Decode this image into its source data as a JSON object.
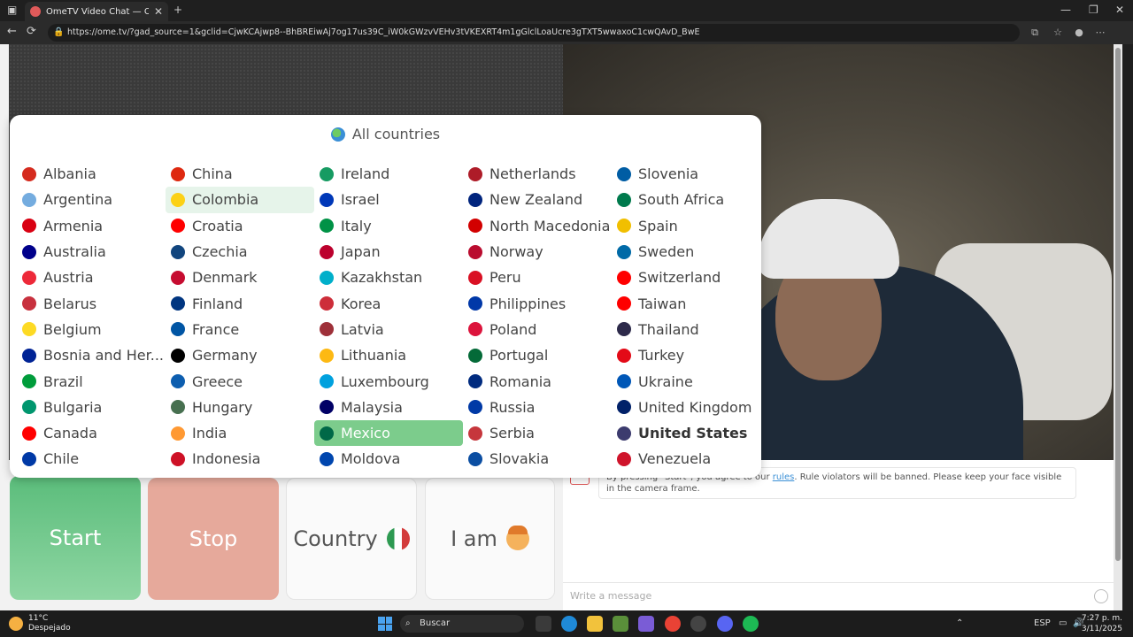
{
  "browser": {
    "tab_title": "OmeTV Video Chat — Ome...",
    "url": "https://ome.tv/?gad_source=1&gclid=CjwKCAjwp8--BhBREiwAj7og17us39C_iW0kGWzvVEHv3tVKEXRT4m1gGlclLoaUcre3gTXT5wwaxoC1cwQAvD_BwE",
    "new_tab": "+",
    "min": "—",
    "restore": "❐",
    "close": "✕",
    "back": "←",
    "reload": "⟳"
  },
  "popup": {
    "title": "All countries",
    "countries": [
      {
        "name": "Albania",
        "flag": "#d52b1e"
      },
      {
        "name": "China",
        "flag": "#de2910"
      },
      {
        "name": "Ireland",
        "flag": "#169b62"
      },
      {
        "name": "Netherlands",
        "flag": "#ae1c28"
      },
      {
        "name": "Slovenia",
        "flag": "#005da4"
      },
      {
        "name": "Argentina",
        "flag": "#74acdf"
      },
      {
        "name": "Colombia",
        "flag": "#fcd116",
        "state": "hover"
      },
      {
        "name": "Israel",
        "flag": "#0038b8"
      },
      {
        "name": "New Zealand",
        "flag": "#00247d"
      },
      {
        "name": "South Africa",
        "flag": "#007a4d"
      },
      {
        "name": "Armenia",
        "flag": "#d90012"
      },
      {
        "name": "Croatia",
        "flag": "#ff0000"
      },
      {
        "name": "Italy",
        "flag": "#009246"
      },
      {
        "name": "North Macedonia",
        "flag": "#d20000"
      },
      {
        "name": "Spain",
        "flag": "#f1bf00"
      },
      {
        "name": "Australia",
        "flag": "#00008b"
      },
      {
        "name": "Czechia",
        "flag": "#11457e"
      },
      {
        "name": "Japan",
        "flag": "#bc002d"
      },
      {
        "name": "Norway",
        "flag": "#ba0c2f"
      },
      {
        "name": "Sweden",
        "flag": "#006aa7"
      },
      {
        "name": "Austria",
        "flag": "#ed2939"
      },
      {
        "name": "Denmark",
        "flag": "#c60c30"
      },
      {
        "name": "Kazakhstan",
        "flag": "#00afca"
      },
      {
        "name": "Peru",
        "flag": "#d91023"
      },
      {
        "name": "Switzerland",
        "flag": "#ff0000"
      },
      {
        "name": "Belarus",
        "flag": "#c8313e"
      },
      {
        "name": "Finland",
        "flag": "#003580"
      },
      {
        "name": "Korea",
        "flag": "#cd2e3a"
      },
      {
        "name": "Philippines",
        "flag": "#0038a8"
      },
      {
        "name": "Taiwan",
        "flag": "#fe0000"
      },
      {
        "name": "Belgium",
        "flag": "#fdda24"
      },
      {
        "name": "France",
        "flag": "#0055a4"
      },
      {
        "name": "Latvia",
        "flag": "#9e3039"
      },
      {
        "name": "Poland",
        "flag": "#dc143c"
      },
      {
        "name": "Thailand",
        "flag": "#2d2a4a"
      },
      {
        "name": "Bosnia and Her...",
        "flag": "#002395"
      },
      {
        "name": "Germany",
        "flag": "#000000"
      },
      {
        "name": "Lithuania",
        "flag": "#fdb913"
      },
      {
        "name": "Portugal",
        "flag": "#046a38"
      },
      {
        "name": "Turkey",
        "flag": "#e30a17"
      },
      {
        "name": "Brazil",
        "flag": "#009c3b"
      },
      {
        "name": "Greece",
        "flag": "#0d5eaf"
      },
      {
        "name": "Luxembourg",
        "flag": "#00a1de"
      },
      {
        "name": "Romania",
        "flag": "#002b7f"
      },
      {
        "name": "Ukraine",
        "flag": "#0057b7"
      },
      {
        "name": "Bulgaria",
        "flag": "#00966e"
      },
      {
        "name": "Hungary",
        "flag": "#477050"
      },
      {
        "name": "Malaysia",
        "flag": "#010066"
      },
      {
        "name": "Russia",
        "flag": "#0039a6"
      },
      {
        "name": "United Kingdom",
        "flag": "#012169"
      },
      {
        "name": "Canada",
        "flag": "#ff0000"
      },
      {
        "name": "India",
        "flag": "#ff9933"
      },
      {
        "name": "Mexico",
        "flag": "#006847",
        "state": "selected"
      },
      {
        "name": "Serbia",
        "flag": "#c6363c"
      },
      {
        "name": "United States",
        "flag": "#3c3b6e",
        "state": "bold"
      },
      {
        "name": "Chile",
        "flag": "#0039a6"
      },
      {
        "name": "Indonesia",
        "flag": "#ce1126"
      },
      {
        "name": "Moldova",
        "flag": "#0046ae"
      },
      {
        "name": "Slovakia",
        "flag": "#0b4ea2"
      },
      {
        "name": "Venezuela",
        "flag": "#cf142b"
      }
    ]
  },
  "buttons": {
    "start": "Start",
    "stop": "Stop",
    "country": "Country",
    "iam": "I am"
  },
  "chat": {
    "notice_pre": "By pressing \"Start\", you agree to our ",
    "notice_link": "rules",
    "notice_post": ". Rule violators will be banned. Please keep your face visible in the camera frame.",
    "input_placeholder": "Write a message"
  },
  "taskbar": {
    "temp": "11°C",
    "weather": "Despejado",
    "search": "Buscar",
    "lang": "ESP",
    "time": "7:27 p. m.",
    "date": "3/11/2025"
  }
}
